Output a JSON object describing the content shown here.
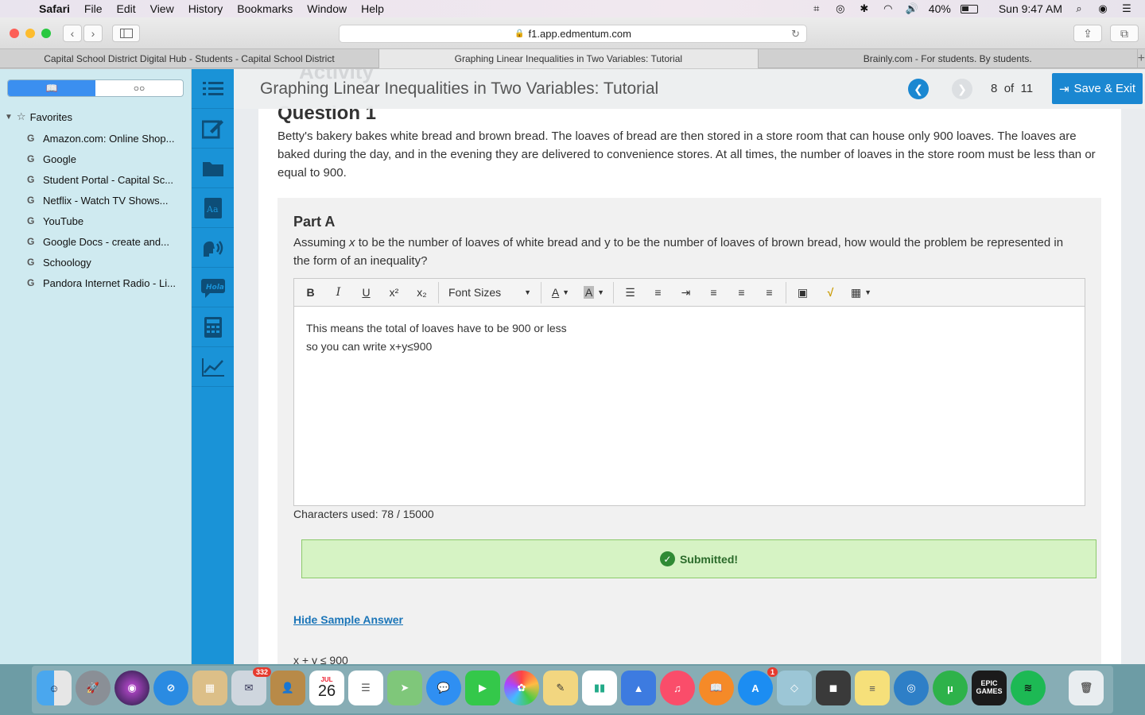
{
  "menubar": {
    "app": "Safari",
    "items": [
      "File",
      "Edit",
      "View",
      "History",
      "Bookmarks",
      "Window",
      "Help"
    ],
    "battery": "40%",
    "clock": "Sun 9:47 AM"
  },
  "browser": {
    "url": "f1.app.edmentum.com",
    "tabs": [
      "Capital School District Digital Hub - Students - Capital School District",
      "Graphing Linear Inequalities in Two Variables: Tutorial",
      "Brainly.com - For students. By students."
    ]
  },
  "sidebar": {
    "favorites_label": "Favorites",
    "bookmarks": [
      "Amazon.com: Online Shop...",
      "Google",
      "Student Portal - Capital Sc...",
      "Netflix - Watch TV Shows...",
      "YouTube",
      "Google Docs - create and...",
      "Schoology",
      "Pandora Internet Radio - Li..."
    ]
  },
  "lesson": {
    "background_heading": "Activity",
    "title": "Graphing Linear Inequalities in Two Variables: Tutorial",
    "page_current": "8",
    "page_of": "of",
    "page_total": "11",
    "save_exit": "Save & Exit"
  },
  "question": {
    "title": "Question 1",
    "text": "Betty's bakery bakes white bread and brown bread. The loaves of bread are then stored in a store room that can house only 900 loaves. The loaves are baked during the day, and in the evening they are delivered to convenience stores. At all times, the number of loaves in the store room must be less than or equal to 900.",
    "part_title": "Part A",
    "part_text_1": "Assuming ",
    "part_var": "x",
    "part_text_2": " to be the number of loaves of white bread and y to be the number of loaves of brown bread, how would the problem be represented in the form of an inequality?"
  },
  "editor": {
    "font_sizes_label": "Font Sizes",
    "answer_line_1": "This means the total of loaves have to be 900 or less",
    "answer_line_2": "so you can write x+y≤900",
    "char_count": "Characters used: 78 / 15000"
  },
  "status": {
    "submitted": "Submitted!",
    "hide_sample": "Hide Sample Answer",
    "sample_answer": "x + y ≤ 900"
  },
  "dock": {
    "mail_badge": "332",
    "calendar_month": "JUL",
    "calendar_day": "26",
    "appstore_badge": "1",
    "epic_label": "EPIC GAMES"
  }
}
